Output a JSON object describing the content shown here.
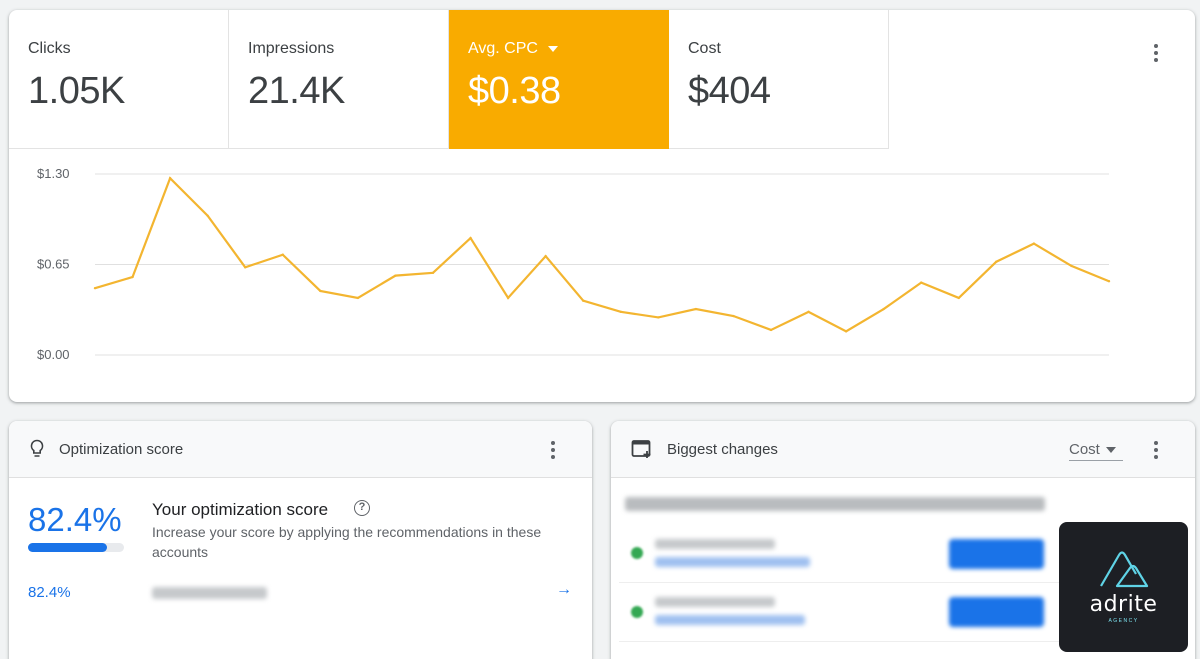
{
  "metrics": [
    {
      "label": "Clicks",
      "value": "1.05K"
    },
    {
      "label": "Impressions",
      "value": "21.4K"
    },
    {
      "label": "Avg. CPC",
      "value": "$0.38",
      "active": true
    },
    {
      "label": "Cost",
      "value": "$404"
    }
  ],
  "colors": {
    "accent": "#f9ab00",
    "line": "#f3b530",
    "blue": "#1a73e8",
    "green": "#34a853"
  },
  "chart_data": {
    "type": "line",
    "title": "",
    "xlabel": "",
    "ylabel": "",
    "ylim": [
      0,
      1.3
    ],
    "yticks": [
      "$1.30",
      "$0.65",
      "$0.00"
    ],
    "grid": true,
    "series": [
      {
        "values": [
          0.48,
          0.56,
          1.27,
          1.0,
          0.63,
          0.72,
          0.46,
          0.41,
          0.57,
          0.59,
          0.84,
          0.41,
          0.71,
          0.39,
          0.31,
          0.27,
          0.33,
          0.28,
          0.18,
          0.31,
          0.17,
          0.33,
          0.52,
          0.41,
          0.67,
          0.8,
          0.64,
          0.53
        ]
      }
    ]
  },
  "optimization": {
    "title": "Optimization score",
    "score": "82.4%",
    "score_fraction": 0.824,
    "heading": "Your optimization score",
    "help": "?",
    "description": "Increase your score by applying the recommendations in these accounts",
    "row_score": "82.4%",
    "arrow": "→"
  },
  "changes": {
    "title": "Biggest changes",
    "dropdown": "Cost"
  },
  "logo": {
    "word": "adrite",
    "sub": "AGENCY"
  }
}
